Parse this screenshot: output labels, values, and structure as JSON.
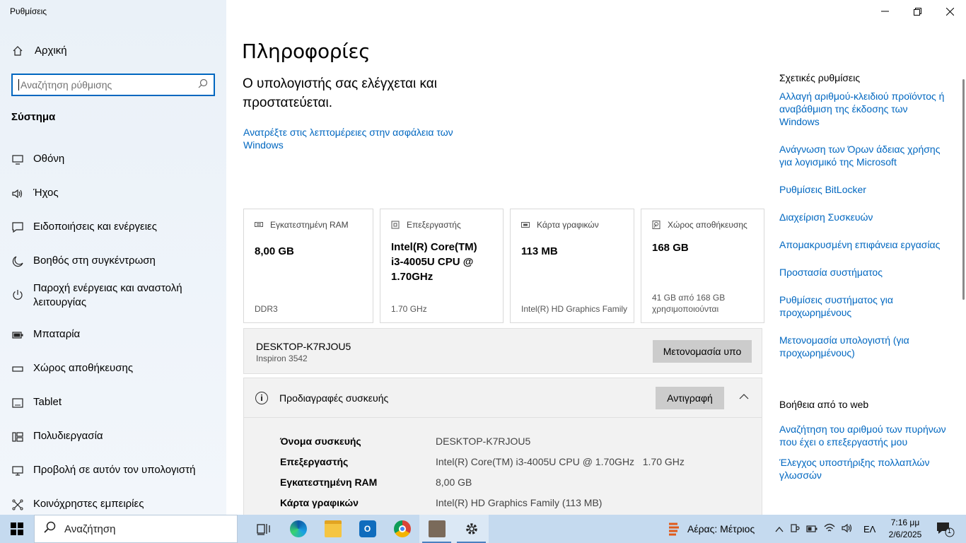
{
  "window": {
    "title": "Ρυθμίσεις",
    "minimize": "—",
    "maximize": "❐",
    "close": "✕"
  },
  "sidebar": {
    "home_label": "Αρχική",
    "search_placeholder": "Αναζήτηση ρύθμισης",
    "section_title": "Σύστημα",
    "items": [
      {
        "label": "Οθόνη",
        "icon": "monitor-icon"
      },
      {
        "label": "Ήχος",
        "icon": "speaker-icon"
      },
      {
        "label": "Ειδοποιήσεις και ενέργειες",
        "icon": "notification-icon"
      },
      {
        "label": "Βοηθός στη συγκέντρωση",
        "icon": "moon-icon"
      },
      {
        "label": "Παροχή ενέργειας και αναστολή λειτουργίας",
        "icon": "power-icon"
      },
      {
        "label": "Μπαταρία",
        "icon": "battery-icon"
      },
      {
        "label": "Χώρος αποθήκευσης",
        "icon": "storage-icon"
      },
      {
        "label": "Tablet",
        "icon": "tablet-icon"
      },
      {
        "label": "Πολυδιεργασία",
        "icon": "multitasking-icon"
      },
      {
        "label": "Προβολή σε αυτόν τον υπολογιστή",
        "icon": "projecting-icon"
      },
      {
        "label": "Κοινόχρηστες εμπειρίες",
        "icon": "shared-icon"
      }
    ]
  },
  "main": {
    "title": "Πληροφορίες",
    "status": "Ο υπολογιστής σας ελέγχεται και προστατεύεται.",
    "security_link": "Ανατρέξτε στις λεπτομέρειες στην ασφάλεια των Windows",
    "cards": [
      {
        "label": "Εγκατεστημένη RAM",
        "value": "8,00 GB",
        "sub": "DDR3",
        "icon": "ram-icon"
      },
      {
        "label": "Επεξεργαστής",
        "value": "Intel(R) Core(TM) i3-4005U CPU @ 1.70GHz",
        "sub": "1.70 GHz",
        "icon": "cpu-icon"
      },
      {
        "label": "Κάρτα γραφικών",
        "value": "113 MB",
        "sub": "Intel(R) HD Graphics Family",
        "icon": "gpu-icon"
      },
      {
        "label": "Χώρος αποθήκευσης",
        "value": "168 GB",
        "sub": "41 GB από 168 GB χρησιμοποιούνται",
        "icon": "disk-icon"
      }
    ],
    "device": {
      "name": "DESKTOP-K7RJOU5",
      "model": "Inspiron 3542",
      "rename_button": "Μετονομασία υπο"
    },
    "specs": {
      "title": "Προδιαγραφές συσκευής",
      "copy_button": "Αντιγραφή",
      "rows": [
        {
          "key": "Όνομα συσκευής",
          "value": "DESKTOP-K7RJOU5"
        },
        {
          "key": "Επεξεργαστής",
          "value": "Intel(R) Core(TM) i3-4005U CPU @ 1.70GHz   1.70 GHz"
        },
        {
          "key": "Εγκατεστημένη RAM",
          "value": "8,00 GB"
        },
        {
          "key": "Κάρτα γραφικών",
          "value": "Intel(R) HD Graphics Family (113 MB)"
        }
      ]
    }
  },
  "related": {
    "title": "Σχετικές ρυθμίσεις",
    "links": [
      "Αλλαγή αριθμού-κλειδιού προϊόντος ή αναβάθμιση της έκδοσης των Windows",
      "Ανάγνωση των Όρων άδειας χρήσης για λογισμικό της Microsoft",
      "Ρυθμίσεις BitLocker",
      "Διαχείριση Συσκευών",
      "Απομακρυσμένη επιφάνεια εργασίας",
      "Προστασία συστήματος",
      "Ρυθμίσεις συστήματος για προχωρημένους",
      "Μετονομασία υπολογιστή (για προχωρημένους)"
    ]
  },
  "help": {
    "title": "Βοήθεια από το web",
    "links": [
      "Αναζήτηση του αριθμού των πυρήνων που έχει ο επεξεργαστής μου",
      "Έλεγχος υποστήριξης πολλαπλών γλωσσών"
    ]
  },
  "taskbar": {
    "search_placeholder": "Αναζήτηση",
    "weather": "Αέρας: Μέτριος",
    "language": "ΕΛ",
    "time": "7:16 μμ",
    "date": "2/6/2025",
    "notification_count": "1"
  }
}
